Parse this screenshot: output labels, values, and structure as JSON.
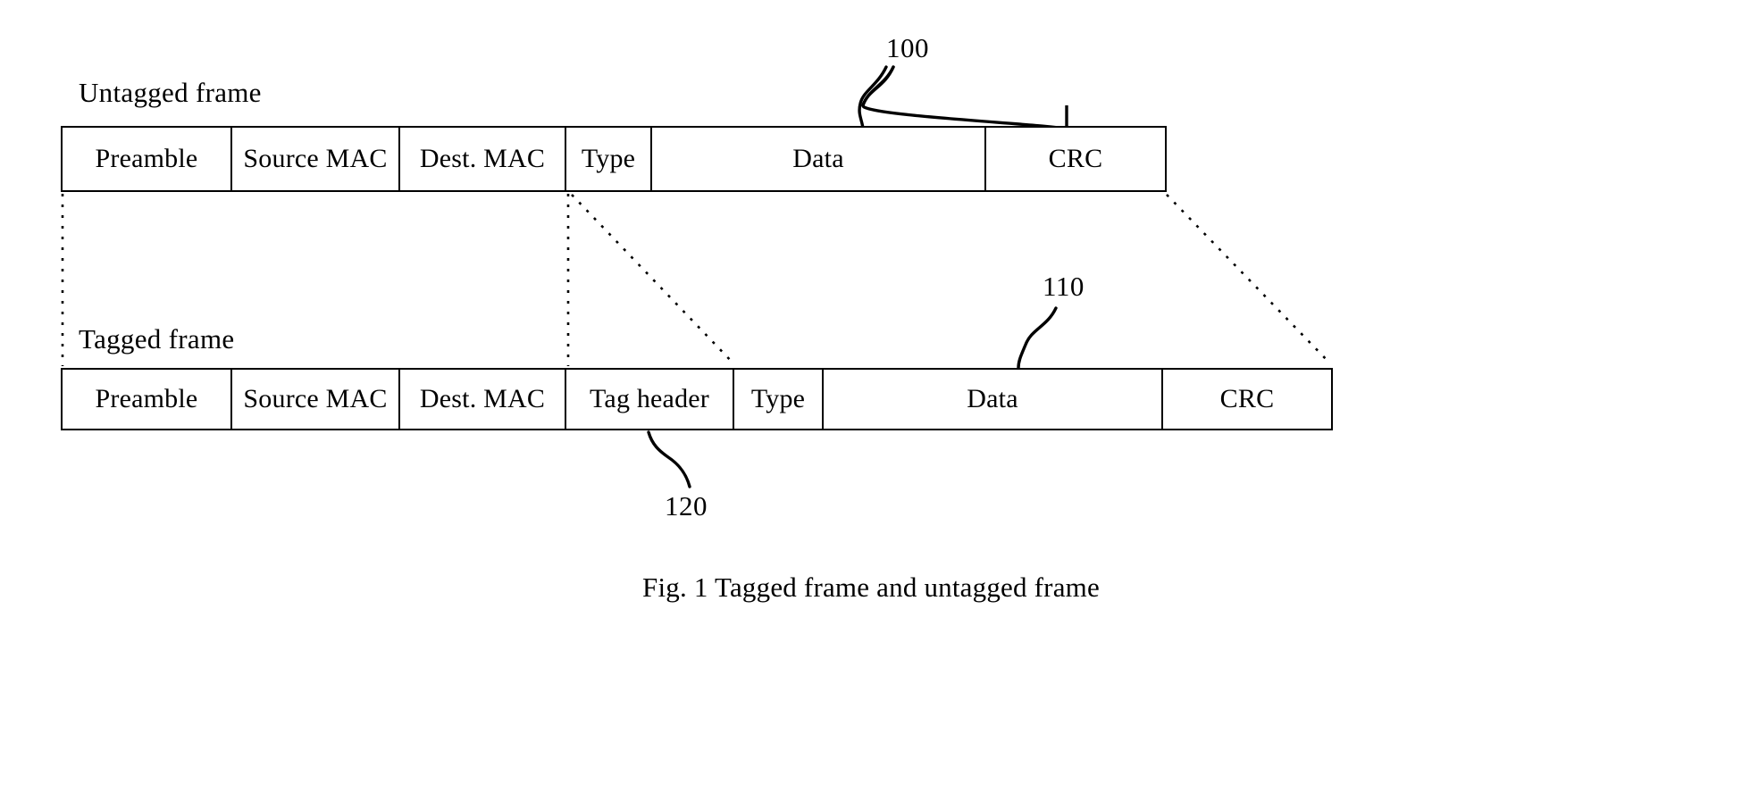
{
  "figure": {
    "caption": "Fig. 1 Tagged frame and untagged frame",
    "untagged": {
      "label": "Untagged frame",
      "cells": [
        {
          "text": "Preamble"
        },
        {
          "text": "Source MAC"
        },
        {
          "text": "Dest. MAC"
        },
        {
          "text": "Type"
        },
        {
          "text": "Data"
        },
        {
          "text": "CRC"
        }
      ]
    },
    "tagged": {
      "label": "Tagged frame",
      "cells": [
        {
          "text": "Preamble"
        },
        {
          "text": "Source MAC"
        },
        {
          "text": "Dest. MAC"
        },
        {
          "text": "Tag header"
        },
        {
          "text": "Type"
        },
        {
          "text": "Data"
        },
        {
          "text": "CRC"
        }
      ]
    },
    "reference_numerals": [
      {
        "id": "100",
        "text": "100"
      },
      {
        "id": "110",
        "text": "110"
      },
      {
        "id": "120",
        "text": "120"
      }
    ],
    "colors": {
      "ink": "#000000",
      "background": "#ffffff"
    }
  }
}
